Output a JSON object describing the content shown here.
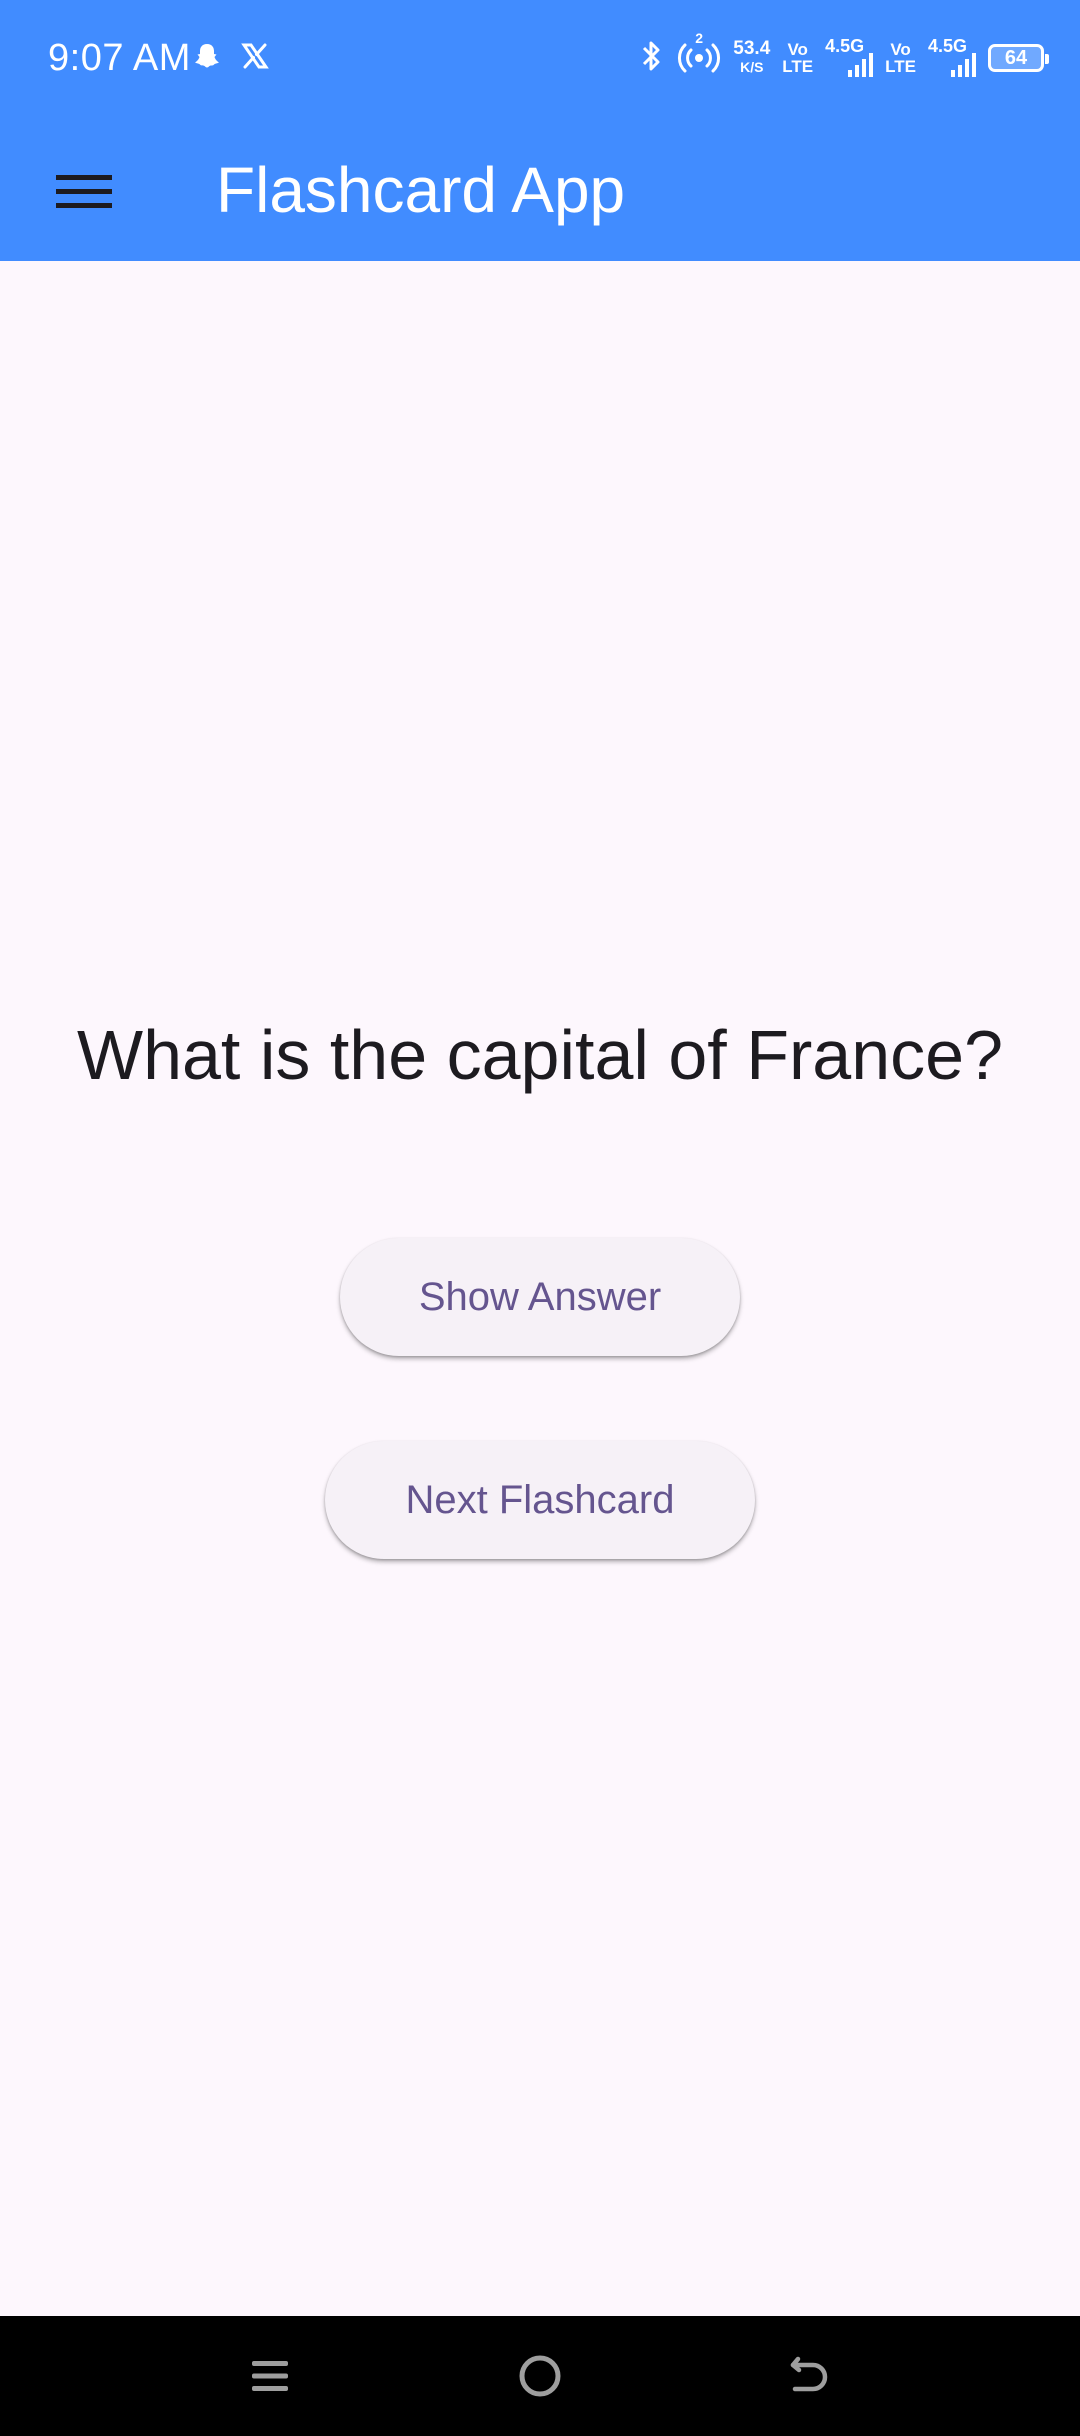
{
  "status_bar": {
    "time": "9:07 AM",
    "net_speed_value": "53.4",
    "net_speed_unit": "K/S",
    "sim1_vo": "Vo",
    "sim1_lte": "LTE",
    "sim1_gen": "4.5G",
    "sim2_vo": "Vo",
    "sim2_lte": "LTE",
    "sim2_gen": "4.5G",
    "hotspot_count": "2",
    "battery_level": "64",
    "icons": [
      "snapchat-icon",
      "x-icon",
      "bluetooth-icon",
      "hotspot-icon",
      "signal-icon",
      "battery-icon"
    ]
  },
  "app_bar": {
    "title": "Flashcard App",
    "menu_icon": "menu-icon"
  },
  "flashcard": {
    "question": "What is the capital of France?",
    "show_answer_label": "Show Answer",
    "next_label": "Next Flashcard"
  },
  "nav_bar": {
    "icons": [
      "recents-icon",
      "home-icon",
      "back-icon"
    ]
  },
  "colors": {
    "app_bar": "#418cff",
    "background": "#fdf7fd",
    "button_text": "#65558f",
    "button_bg": "#f6f1f7",
    "question_text": "#1d1b20"
  }
}
